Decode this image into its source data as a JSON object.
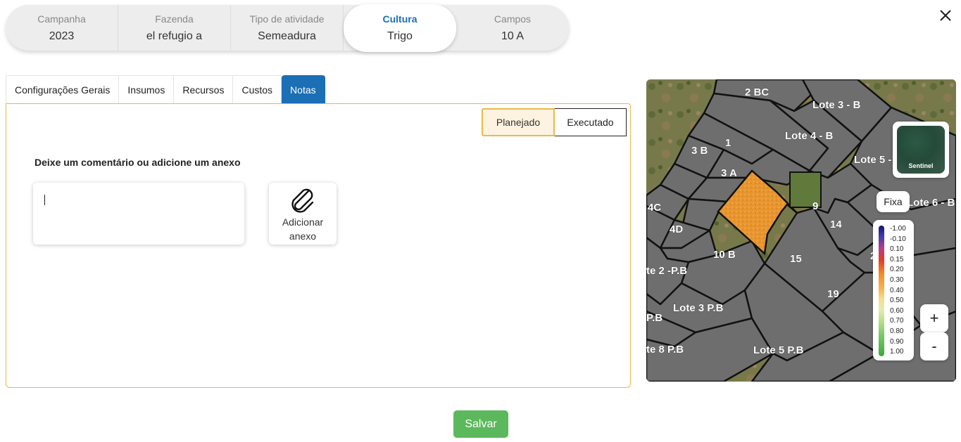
{
  "steps": [
    {
      "label": "Campanha",
      "value": "2023"
    },
    {
      "label": "Fazenda",
      "value": "el refugio a"
    },
    {
      "label": "Tipo de atividade",
      "value": "Semeadura"
    },
    {
      "label": "Cultura",
      "value": "Trigo"
    },
    {
      "label": "Campos",
      "value": "10 A"
    }
  ],
  "tabs": [
    "Configurações Gerais",
    "Insumos",
    "Recursos",
    "Custos",
    "Notas"
  ],
  "active_tab": "Notas",
  "toggle": {
    "planned": "Planejado",
    "executed": "Executado",
    "selected": "Planejado"
  },
  "notes": {
    "prompt": "Deixe um comentário ou adicione um anexo",
    "comment_value": "",
    "attach_label_line1": "Adicionar",
    "attach_label_line2": "anexo"
  },
  "save_label": "Salvar",
  "map": {
    "sentinel_label": "Sentinel",
    "fixa_label": "Fixa",
    "zoom_in": "+",
    "zoom_out": "-",
    "legend_values": [
      "-1.00",
      "-0.10",
      "0.10",
      "0.15",
      "0.20",
      "0.30",
      "0.40",
      "0.50",
      "0.60",
      "0.70",
      "0.80",
      "0.90",
      "1.00"
    ],
    "field_labels": [
      "2 BC",
      "Lote 3 - B",
      "Lote 4 - B",
      "Lote 5 -",
      "1",
      "3 B",
      "3 A",
      "9",
      "Lote 6 - B",
      "4C",
      "14",
      "4D",
      "10 B",
      "15",
      "te 2 -P.B",
      "19",
      "Lote 3 P.B",
      "P.B",
      "te 8 P.B",
      "Lote 5 P.B",
      "2"
    ],
    "selected_field_color": "#e8962f",
    "field_color": "#6e6e6e"
  }
}
